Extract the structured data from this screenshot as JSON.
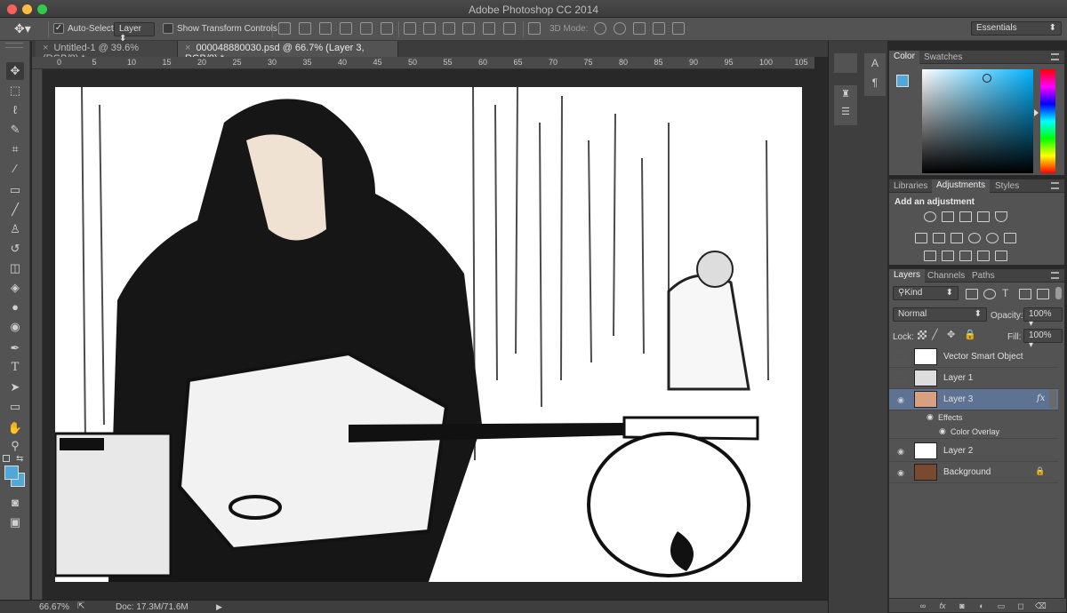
{
  "app": {
    "title": "Adobe Photoshop CC 2014"
  },
  "options": {
    "auto_select_label": "Auto-Select:",
    "auto_select_target": "Layer",
    "transform_label": "Show Transform Controls",
    "mode_3d_label": "3D Mode:",
    "workspace": "Essentials"
  },
  "tabs": [
    {
      "label": "Untitled-1 @ 39.6% (RGB/8) *",
      "active": false
    },
    {
      "label": "000048880030.psd @ 66.7% (Layer 3, RGB/8) *",
      "active": true
    }
  ],
  "ruler": {
    "marks": [
      "0",
      "5",
      "10",
      "15",
      "20",
      "25",
      "30",
      "35",
      "40",
      "45",
      "50",
      "55",
      "60",
      "65",
      "70",
      "75",
      "80",
      "85",
      "90",
      "95",
      "100",
      "105"
    ]
  },
  "status": {
    "zoom": "66.67%",
    "doc": "Doc: 17.3M/71.6M"
  },
  "color_panel": {
    "tabs": [
      "Color",
      "Swatches"
    ],
    "fg": "#4fa8d8"
  },
  "adjustments_panel": {
    "tabs": [
      "Libraries",
      "Adjustments",
      "Styles"
    ],
    "heading": "Add an adjustment"
  },
  "layers_panel": {
    "tabs": [
      "Layers",
      "Channels",
      "Paths"
    ],
    "filter": "Kind",
    "blend_mode": "Normal",
    "opacity_label": "Opacity:",
    "opacity": "100%",
    "lock_label": "Lock:",
    "fill_label": "Fill:",
    "fill": "100%",
    "layers": [
      {
        "name": "Vector Smart Object",
        "visible": false,
        "selected": false
      },
      {
        "name": "Layer 1",
        "visible": false,
        "selected": false
      },
      {
        "name": "Layer 3",
        "visible": true,
        "selected": true,
        "fx": "fx"
      },
      {
        "name": "Effects",
        "sub": true
      },
      {
        "name": "Color Overlay",
        "sub": true
      },
      {
        "name": "Layer 2",
        "visible": true,
        "selected": false
      },
      {
        "name": "Background",
        "visible": true,
        "selected": false
      }
    ]
  }
}
